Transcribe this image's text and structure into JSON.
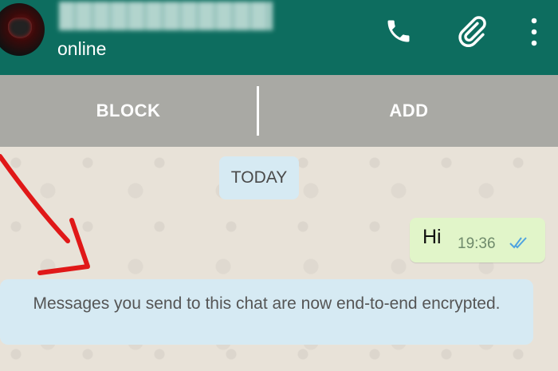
{
  "header": {
    "contact_name": "██████████",
    "status": "online"
  },
  "actions": {
    "block_label": "BLOCK",
    "add_label": "ADD"
  },
  "chat": {
    "date_chip": "TODAY",
    "messages": [
      {
        "text": "Hi",
        "time": "19:36",
        "status": "read"
      }
    ],
    "system_notice": "Messages you send to this chat are now end-to-end encrypted."
  },
  "colors": {
    "header": "#0d6d5f",
    "outgoing_bubble": "#e1f5c9",
    "system_bubble": "#d6eaf3",
    "read_ticks": "#4fa3e0",
    "annotation_arrow": "#e01818"
  }
}
